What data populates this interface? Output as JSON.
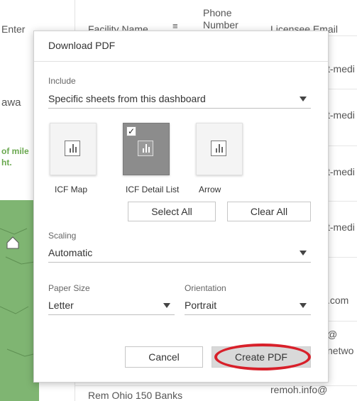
{
  "background": {
    "header_fragment": "Enter",
    "col_facility_name": "Facility Name",
    "col_phone_line1": "Phone",
    "col_phone_line2": "Number",
    "col_licensee_email": "Licensee Email",
    "left_fragment_1": "awa",
    "left_green_1": "of mile",
    "left_green_2": "ht.",
    "email_fragments": [
      "t-medi",
      "t-medi",
      "t-medi",
      "t-medi",
      ".com",
      "@",
      "netwo"
    ],
    "bottom_facility": "Rem Ohio 150 Banks",
    "bottom_email": "remoh.info@"
  },
  "dialog": {
    "title": "Download PDF",
    "include": {
      "label": "Include",
      "value": "Specific sheets from this dashboard"
    },
    "sheets": [
      {
        "label": "ICF Map",
        "selected": false
      },
      {
        "label": "ICF Detail List",
        "selected": true
      },
      {
        "label": "Arrow",
        "selected": false
      }
    ],
    "check_mark": "✓",
    "select_all_label": "Select All",
    "clear_all_label": "Clear All",
    "scaling": {
      "label": "Scaling",
      "value": "Automatic"
    },
    "paper_size": {
      "label": "Paper Size",
      "value": "Letter"
    },
    "orientation": {
      "label": "Orientation",
      "value": "Portrait"
    },
    "cancel_label": "Cancel",
    "create_label": "Create PDF"
  },
  "colors": {
    "highlight_ring": "#d8202a",
    "selected_thumb": "#8c8c8c",
    "map_green": "#7fb572"
  }
}
